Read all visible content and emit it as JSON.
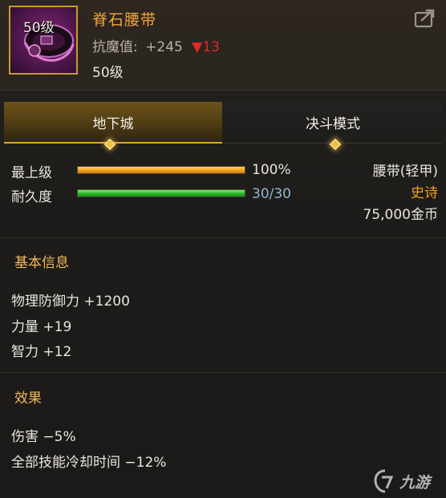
{
  "item": {
    "name": "脊石腰带",
    "level_badge": "50级",
    "stat_label": "抗魔值:",
    "stat_value": "+245",
    "stat_change": "▼13",
    "required_level": "50级"
  },
  "tabs": [
    {
      "label": "地下城",
      "active": true
    },
    {
      "label": "决斗模式",
      "active": false
    }
  ],
  "bars": {
    "grade": {
      "label": "最上级",
      "value_text": "100%",
      "fill": 1.0,
      "color": "#f5a41e"
    },
    "durability": {
      "label": "耐久度",
      "value_text": "30/30",
      "fill": 1.0,
      "color": "#2fbf2a"
    }
  },
  "info": {
    "type": "腰带(轻甲)",
    "rarity": "史诗",
    "price": "75,000金币"
  },
  "basic": {
    "title": "基本信息",
    "lines": [
      "物理防御力 +1200",
      "力量 +19",
      "智力 +12"
    ]
  },
  "effects": {
    "title": "效果",
    "lines": [
      "伤害 −5%",
      "全部技能冷却时间 −12%"
    ]
  },
  "watermark": {
    "text": "九游"
  },
  "colors": {
    "accent": "#f2a33a",
    "rarity": "#f0a020",
    "down": "#e02929",
    "durability_text": "#8fb6d6"
  }
}
